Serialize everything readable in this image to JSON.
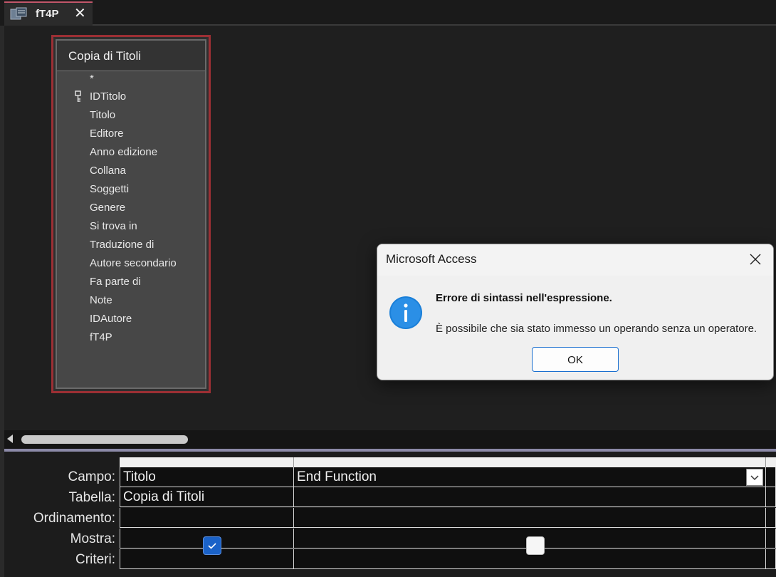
{
  "tab": {
    "label": "fT4P",
    "icon": "query-design-icon",
    "close_glyph": "✕"
  },
  "table_box": {
    "title": "Copia di Titoli",
    "fields": [
      {
        "label": "*",
        "key": false
      },
      {
        "label": "IDTitolo",
        "key": true
      },
      {
        "label": "Titolo",
        "key": false
      },
      {
        "label": "Editore",
        "key": false
      },
      {
        "label": "Anno edizione",
        "key": false
      },
      {
        "label": "Collana",
        "key": false
      },
      {
        "label": "Soggetti",
        "key": false
      },
      {
        "label": "Genere",
        "key": false
      },
      {
        "label": "Si trova in",
        "key": false
      },
      {
        "label": "Traduzione di",
        "key": false
      },
      {
        "label": "Autore secondario",
        "key": false
      },
      {
        "label": "Fa parte di",
        "key": false
      },
      {
        "label": "Note",
        "key": false
      },
      {
        "label": "IDAutore",
        "key": false
      },
      {
        "label": "fT4P",
        "key": false
      }
    ]
  },
  "qbe_grid": {
    "row_labels": {
      "campo": "Campo:",
      "tabella": "Tabella:",
      "ordinamento": "Ordinamento:",
      "mostra": "Mostra:",
      "criteri": "Criteri:"
    },
    "columns": [
      {
        "campo": "Titolo",
        "tabella": "Copia di Titoli",
        "ordinamento": "",
        "mostra": true,
        "criteri": ""
      },
      {
        "campo": "End Function",
        "tabella": "",
        "ordinamento": "",
        "mostra": false,
        "criteri": ""
      }
    ]
  },
  "dialog": {
    "title": "Microsoft Access",
    "icon": "info-icon",
    "heading": "Errore di sintassi nell'espressione.",
    "message": "È possibile che sia stato immesso un operando senza un operatore.",
    "ok_label": "OK"
  },
  "colors": {
    "table_border": "#9c2f34",
    "tab_accent": "#c2566a",
    "checkbox_checked": "#1a62c8",
    "info_blue": "#1a7fd8",
    "ok_border": "#1a6fcf"
  }
}
